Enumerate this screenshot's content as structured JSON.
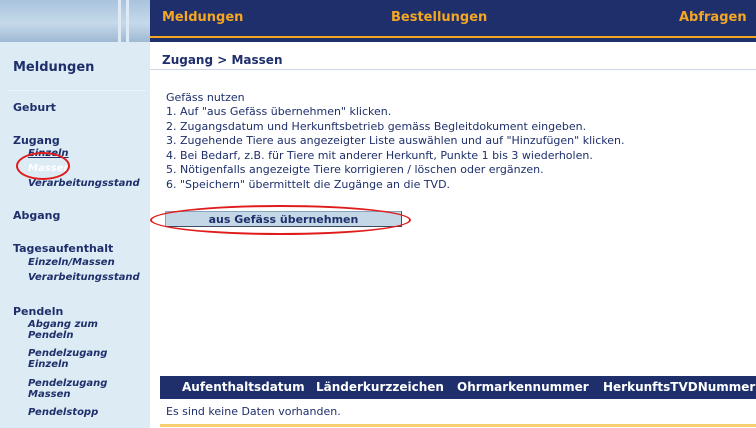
{
  "topnav": {
    "items": [
      {
        "label": "Meldungen"
      },
      {
        "label": "Bestellungen"
      },
      {
        "label": "Abfragen"
      }
    ]
  },
  "sidebar": {
    "title": "Meldungen",
    "geburt": "Geburt",
    "zugang": {
      "label": "Zugang",
      "einzeln": "Einzeln",
      "massen": "Massen",
      "verarbeitungsstand": "Verarbeitungsstand"
    },
    "abgang": "Abgang",
    "tagesaufenthalt": {
      "label": "Tagesaufenthalt",
      "einzeln_massen": "Einzeln/Massen",
      "verarbeitungsstand": "Verarbeitungsstand"
    },
    "pendeln": {
      "label": "Pendeln",
      "abgang_zum_pendeln": [
        "Abgang zum",
        "Pendeln"
      ],
      "pendelzugang_einzeln": [
        "Pendelzugang",
        "Einzeln"
      ],
      "pendelzugang_massen": [
        "Pendelzugang",
        "Massen"
      ],
      "pendelstopp": "Pendelstopp"
    }
  },
  "main": {
    "breadcrumb": "Zugang > Massen",
    "intro": "Gefäss nutzen",
    "steps": [
      "1. Auf \"aus Gefäss übernehmen\" klicken.",
      "2. Zugangsdatum und Herkunftsbetrieb gemäss Begleitdokument eingeben.",
      "3. Zugehende Tiere aus angezeigter Liste auswählen und auf \"Hinzufügen\" klicken.",
      "4. Bei Bedarf, z.B. für Tiere mit anderer Herkunft, Punkte 1 bis 3 wiederholen.",
      "5. Nötigenfalls angezeigte Tiere korrigieren / löschen oder ergänzen.",
      "6. \"Speichern\" übermittelt die Zugänge an die TVD."
    ],
    "button_label": "aus Gefäss übernehmen"
  },
  "table": {
    "columns": [
      "Aufenthaltsdatum",
      "Länderkurzzeichen",
      "Ohrmarkennummer",
      "HerkunftsTVDNummer"
    ],
    "empty_message": "Es sind keine Daten vorhanden."
  },
  "colors": {
    "nav_bg": "#1e2f6b",
    "nav_text": "#f5a623",
    "sidebar_bg": "#dcebf4",
    "annotation": "#e01b1b"
  }
}
